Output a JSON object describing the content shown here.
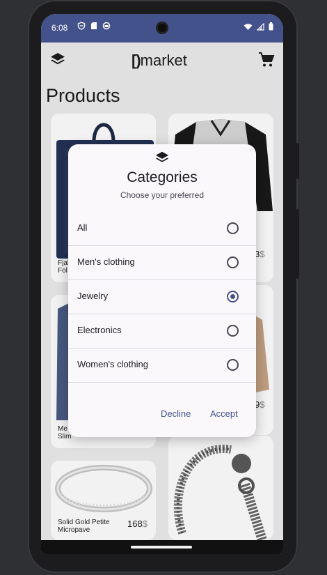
{
  "status": {
    "time": "6:08",
    "icons": [
      "shield-icon",
      "sd-card-icon",
      "circle-icon"
    ],
    "right_icons": [
      "wifi-icon",
      "signal-icon",
      "battery-icon"
    ]
  },
  "appbar": {
    "logo_bracket": "[)",
    "logo_text": "market",
    "menu_icon": "layers-icon",
    "cart_icon": "cart-icon"
  },
  "page": {
    "title": "Products"
  },
  "products": [
    {
      "name": "Fjal\nFol",
      "price": "",
      "currency": ""
    },
    {
      "name": "",
      "price": "3",
      "currency": "$"
    },
    {
      "name": "",
      "price": "",
      "currency": ""
    },
    {
      "name": "",
      "price": "9",
      "currency": "$"
    },
    {
      "name": "Me\nSlim",
      "price": "",
      "currency": ""
    },
    {
      "name": "Solid Gold Petite\nMicropave",
      "price": "168",
      "currency": "$"
    },
    {
      "name": "",
      "price": "",
      "currency": ""
    }
  ],
  "dialog": {
    "icon": "layers-icon",
    "title": "Categories",
    "subtitle": "Choose your preferred",
    "options": [
      {
        "label": "All",
        "selected": false
      },
      {
        "label": "Men's clothing",
        "selected": false
      },
      {
        "label": "Jewelry",
        "selected": true
      },
      {
        "label": "Electronics",
        "selected": false
      },
      {
        "label": "Women's clothing",
        "selected": false
      }
    ],
    "decline_label": "Decline",
    "accept_label": "Accept"
  },
  "colors": {
    "primary": "#44528b",
    "screen_bg": "#ececec",
    "dialog_bg": "#fbf8fc"
  }
}
